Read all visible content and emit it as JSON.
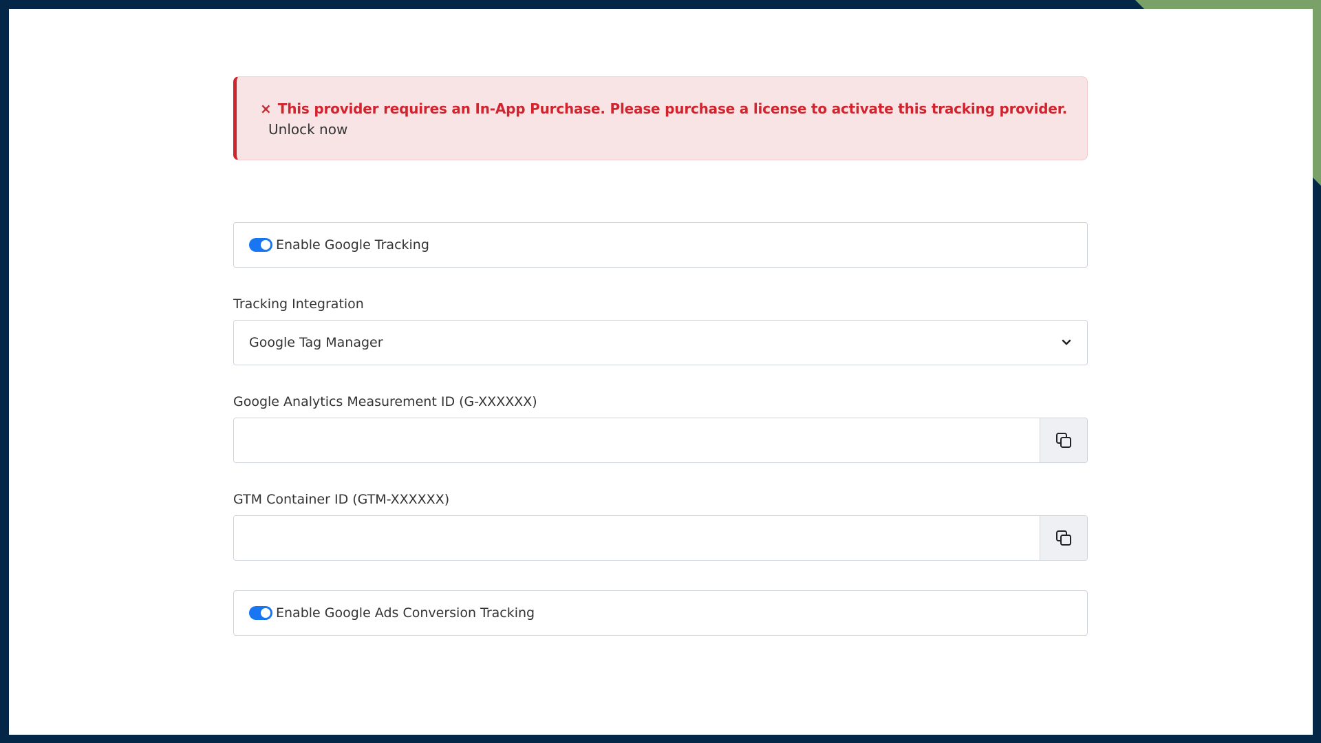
{
  "alert": {
    "icon": "close-icon",
    "message": "This provider requires an In-App Purchase. Please purchase a license to activate this tracking provider.",
    "link_label": "Unlock now",
    "color": "#d1242f"
  },
  "google_tracking": {
    "label": "Enable Google Tracking",
    "enabled": true
  },
  "tracking_integration": {
    "label": "Tracking Integration",
    "selected": "Google Tag Manager",
    "icon": "chevron-down-icon"
  },
  "ga_measurement": {
    "label": "Google Analytics Measurement ID (G-XXXXXX)",
    "value": "",
    "icon": "copy-icon"
  },
  "gtm_container": {
    "label": "GTM Container ID (GTM-XXXXXX)",
    "value": "",
    "icon": "copy-icon"
  },
  "ads_conversion": {
    "label": "Enable Google Ads Conversion Tracking",
    "enabled": true
  },
  "colors": {
    "accent": "#1976f2",
    "frame": "#042748",
    "corner": "#7aa268"
  }
}
